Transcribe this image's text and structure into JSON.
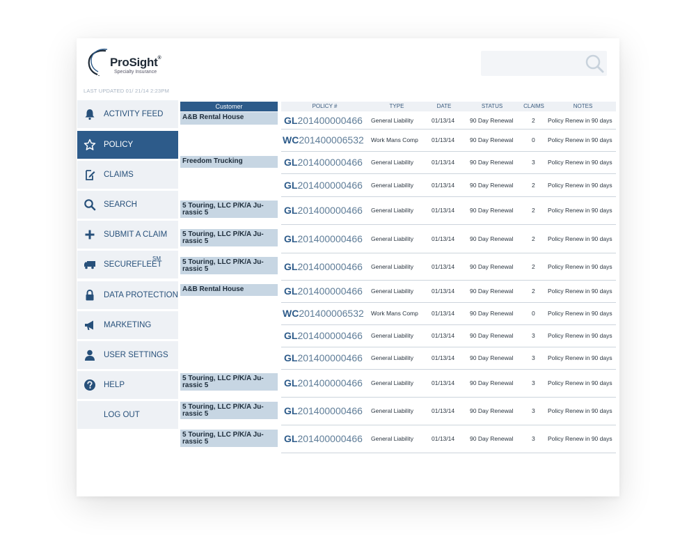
{
  "brand": {
    "name": "ProSight",
    "registered": "®",
    "subtitle": "Specialty Insurance"
  },
  "last_updated": "LAST UPDATED  01/ 21/14  2:23PM",
  "search": {
    "icon": "search-icon"
  },
  "colors": {
    "primary": "#2d5b8a",
    "nav_bg": "#eef1f5",
    "customer_bg": "#c7d6e3",
    "text_blue": "#27507a"
  },
  "sidebar": {
    "items": [
      {
        "label": "ACTIVITY FEED",
        "icon": "bell-icon",
        "active": false
      },
      {
        "label": "POLICY",
        "icon": "star-icon",
        "active": true
      },
      {
        "label": "CLAIMS",
        "icon": "edit-document-icon",
        "active": false
      },
      {
        "label": "SEARCH",
        "icon": "search-icon",
        "active": false
      },
      {
        "label": "SUBMIT A CLAIM",
        "icon": "plus-icon",
        "active": false
      },
      {
        "label": "SECUREFLEET",
        "sup": "SM",
        "icon": "truck-icon",
        "active": false
      },
      {
        "label": "DATA PROTECTION",
        "icon": "lock-icon",
        "active": false
      },
      {
        "label": "MARKETING",
        "icon": "megaphone-icon",
        "active": false
      },
      {
        "label": "USER SETTINGS",
        "icon": "user-icon",
        "active": false
      },
      {
        "label": "HELP",
        "icon": "question-icon",
        "active": false
      },
      {
        "label": "LOG OUT",
        "icon": "",
        "active": false
      }
    ]
  },
  "table": {
    "customer_header": "Customer",
    "headers": {
      "policy": "POLICY #",
      "type": "TYPE",
      "date": "DATE",
      "status": "STATUS",
      "claims": "CLAIMS",
      "notes": "NOTES"
    },
    "customers": [
      {
        "line1": "A&B Rental House",
        "line2": ""
      },
      {
        "line1": "Freedom Trucking",
        "line2": ""
      },
      {
        "line1": "5 Touring, LLC P/K/A Ju-",
        "line2": "rassic 5"
      },
      {
        "line1": "5 Touring, LLC P/K/A Ju-",
        "line2": "rassic 5"
      },
      {
        "line1": "5 Touring, LLC P/K/A Ju-",
        "line2": "rassic 5"
      },
      {
        "line1": "A&B Rental House",
        "line2": ""
      },
      {
        "line1": "5 Touring, LLC P/K/A Ju-",
        "line2": "rassic 5"
      },
      {
        "line1": "5 Touring, LLC P/K/A Ju-",
        "line2": "rassic 5"
      },
      {
        "line1": "5 Touring, LLC P/K/A Ju-",
        "line2": "rassic 5"
      }
    ],
    "rows": [
      {
        "prefix": "GL",
        "number": "201400000466",
        "type": "General Liability",
        "date": "01/13/14",
        "status": "90 Day Renewal",
        "claims": "2",
        "notes": "Policy Renew in 90 days"
      },
      {
        "prefix": "WC",
        "number": "201400006532",
        "type": "Work Mans Comp",
        "date": "01/13/14",
        "status": "90 Day Renewal",
        "claims": "0",
        "notes": "Policy Renew in 90 days"
      },
      {
        "prefix": "GL",
        "number": "201400000466",
        "type": "General Liability",
        "date": "01/13/14",
        "status": "90 Day Renewal",
        "claims": "3",
        "notes": "Policy Renew in 90 days"
      },
      {
        "prefix": "GL",
        "number": "201400000466",
        "type": "General Liability",
        "date": "01/13/14",
        "status": "90 Day Renewal",
        "claims": "2",
        "notes": "Policy Renew in 90 days"
      },
      {
        "prefix": "GL",
        "number": "201400000466",
        "type": "General Liability",
        "date": "01/13/14",
        "status": "90 Day Renewal",
        "claims": "2",
        "notes": "Policy Renew in 90 days"
      },
      {
        "prefix": "GL",
        "number": "201400000466",
        "type": "General Liability",
        "date": "01/13/14",
        "status": "90 Day Renewal",
        "claims": "2",
        "notes": "Policy Renew in 90 days"
      },
      {
        "prefix": "GL",
        "number": "201400000466",
        "type": "General Liability",
        "date": "01/13/14",
        "status": "90 Day Renewal",
        "claims": "2",
        "notes": "Policy Renew in 90 days"
      },
      {
        "prefix": "GL",
        "number": "201400000466",
        "type": "General Liability",
        "date": "01/13/14",
        "status": "90 Day Renewal",
        "claims": "2",
        "notes": "Policy Renew in 90 days"
      },
      {
        "prefix": "WC",
        "number": "201400006532",
        "type": "Work Mans Comp",
        "date": "01/13/14",
        "status": "90 Day Renewal",
        "claims": "0",
        "notes": "Policy Renew in 90 days"
      },
      {
        "prefix": "GL",
        "number": "201400000466",
        "type": "General Liability",
        "date": "01/13/14",
        "status": "90 Day Renewal",
        "claims": "3",
        "notes": "Policy Renew in 90 days"
      },
      {
        "prefix": "GL",
        "number": "201400000466",
        "type": "General Liability",
        "date": "01/13/14",
        "status": "90 Day Renewal",
        "claims": "3",
        "notes": "Policy Renew in 90 days"
      },
      {
        "prefix": "GL",
        "number": "201400000466",
        "type": "General Liability",
        "date": "01/13/14",
        "status": "90 Day Renewal",
        "claims": "3",
        "notes": "Policy Renew in 90 days"
      },
      {
        "prefix": "GL",
        "number": "201400000466",
        "type": "General Liability",
        "date": "01/13/14",
        "status": "90 Day Renewal",
        "claims": "3",
        "notes": "Policy Renew in 90 days"
      },
      {
        "prefix": "GL",
        "number": "201400000466",
        "type": "General Liability",
        "date": "01/13/14",
        "status": "90 Day Renewal",
        "claims": "3",
        "notes": "Policy Renew in 90 days"
      }
    ]
  }
}
